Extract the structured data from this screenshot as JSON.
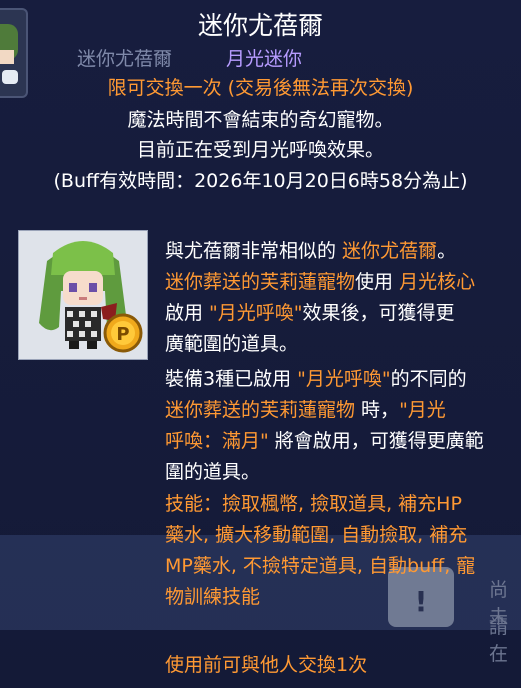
{
  "item": {
    "title": "迷你尤蓓爾",
    "sub_name": "迷你尤蓓爾",
    "sub_tag": "月光迷你",
    "trade_note": "限可交換一次 (交易後無法再次交換)",
    "line1": "魔法時間不會結束的奇幻寵物。",
    "line2": "目前正在受到月光呼喚效果。",
    "buff_line": "(Buff有效時間：2026年10月20日6時58分為止)"
  },
  "description": {
    "l1a": "與尤蓓爾非常相似的 ",
    "l1b": "迷你尤蓓爾",
    "l1c": "。",
    "l2a": "迷你葬送的芙莉蓮寵物",
    "l2b": "使用 ",
    "l2c": "月光核心",
    "l3a": "啟用 ",
    "l3b": "\"月光呼喚\"",
    "l3c": "效果後，可獲得更",
    "l4": "廣範圍的道具。",
    "l5a": "裝備3種已啟用 ",
    "l5b": "\"月光呼喚\"",
    "l5c": "的不同的",
    "l6a": "迷你葬送的芙莉蓮寵物",
    "l6b": " 時，",
    "l6c": "\"月光",
    "l7a": "呼喚：滿月\"",
    "l7b": " 將會啟用，可獲得更廣範",
    "l8": "圍的道具。",
    "skills1": "技能：撿取楓幣, 撿取道具, 補充HP",
    "skills2": "藥水, 擴大移動範圍, 自動撿取, 補充",
    "skills3": "MP藥水, 不撿特定道具, 自動buff, 寵",
    "skills4": "物訓練技能",
    "trade_before": "使用前可與他人交換1次"
  },
  "background": {
    "text1": "尚未",
    "text2": "請在",
    "lock_mark": "!"
  },
  "colors": {
    "orange": "#ff9933",
    "purple": "#b79cff",
    "bg": "#141b3a"
  },
  "icons": {
    "item_icon": "pet-portrait-icon",
    "coin_icon": "p-coin-icon"
  }
}
